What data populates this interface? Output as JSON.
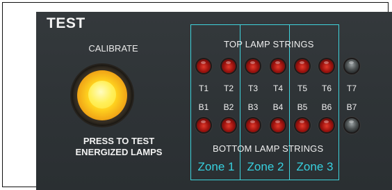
{
  "panel": {
    "title": "TEST",
    "calibrate_label": "CALIBRATE",
    "press_line1": "PRESS TO TEST",
    "press_line2": "ENERGIZED LAMPS"
  },
  "strings": {
    "top_title": "TOP LAMP STRINGS",
    "bottom_title": "BOTTOM LAMP STRINGS"
  },
  "zones": [
    "Zone 1",
    "Zone 2",
    "Zone 3"
  ],
  "top_lamps": [
    {
      "label": "T1",
      "state": "red"
    },
    {
      "label": "T2",
      "state": "red"
    },
    {
      "label": "T3",
      "state": "red"
    },
    {
      "label": "T4",
      "state": "red"
    },
    {
      "label": "T5",
      "state": "red"
    },
    {
      "label": "T6",
      "state": "red"
    },
    {
      "label": "T7",
      "state": "off"
    }
  ],
  "bottom_lamps": [
    {
      "label": "B1",
      "state": "red"
    },
    {
      "label": "B2",
      "state": "red"
    },
    {
      "label": "B3",
      "state": "red"
    },
    {
      "label": "B4",
      "state": "red"
    },
    {
      "label": "B5",
      "state": "red"
    },
    {
      "label": "B6",
      "state": "red"
    },
    {
      "label": "B7",
      "state": "off"
    }
  ],
  "colors": {
    "zone_outline": "#3fd3dc",
    "lamp_on": "#c0201a",
    "button_glow": "#ffe033"
  }
}
